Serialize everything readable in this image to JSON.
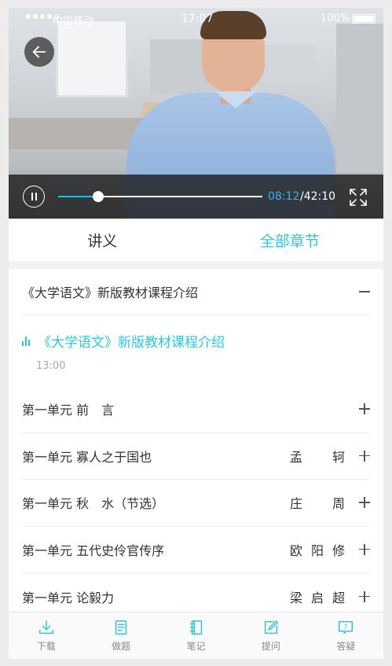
{
  "status_bar": {
    "carrier": "中国移动",
    "time": "17:07",
    "battery": "100%"
  },
  "player": {
    "current_time": "08:12",
    "total_time": "/42:10",
    "progress": 0.1946
  },
  "tabs": [
    {
      "label": "讲义",
      "active": false
    },
    {
      "label": "全部章节",
      "active": true
    }
  ],
  "chapter": {
    "title": "《大学语文》新版教材课程介绍",
    "playing_item": {
      "title": "《大学语文》新版教材课程介绍",
      "duration": "13:00"
    }
  },
  "units": [
    {
      "label": "第一单元 前　言",
      "author": ""
    },
    {
      "label": "第一单元 寡人之于国也",
      "author": "孟轲"
    },
    {
      "label": "第一单元 秋　水（节选）",
      "author": "庄周"
    },
    {
      "label": "第一单元 五代史伶官传序",
      "author": "欧阳修"
    },
    {
      "label": "第一单元 论毅力",
      "author": "梁启超"
    }
  ],
  "bottom_nav": [
    {
      "label": "下载",
      "icon": "download-icon"
    },
    {
      "label": "做题",
      "icon": "exercise-icon"
    },
    {
      "label": "笔记",
      "icon": "notebook-icon"
    },
    {
      "label": "提问",
      "icon": "edit-question-icon"
    },
    {
      "label": "答疑",
      "icon": "qa-icon"
    }
  ],
  "colors": {
    "accent": "#2fc4de",
    "progress": "#2fb6e8",
    "text": "#333333",
    "nav_icon": "#2fc4de"
  }
}
